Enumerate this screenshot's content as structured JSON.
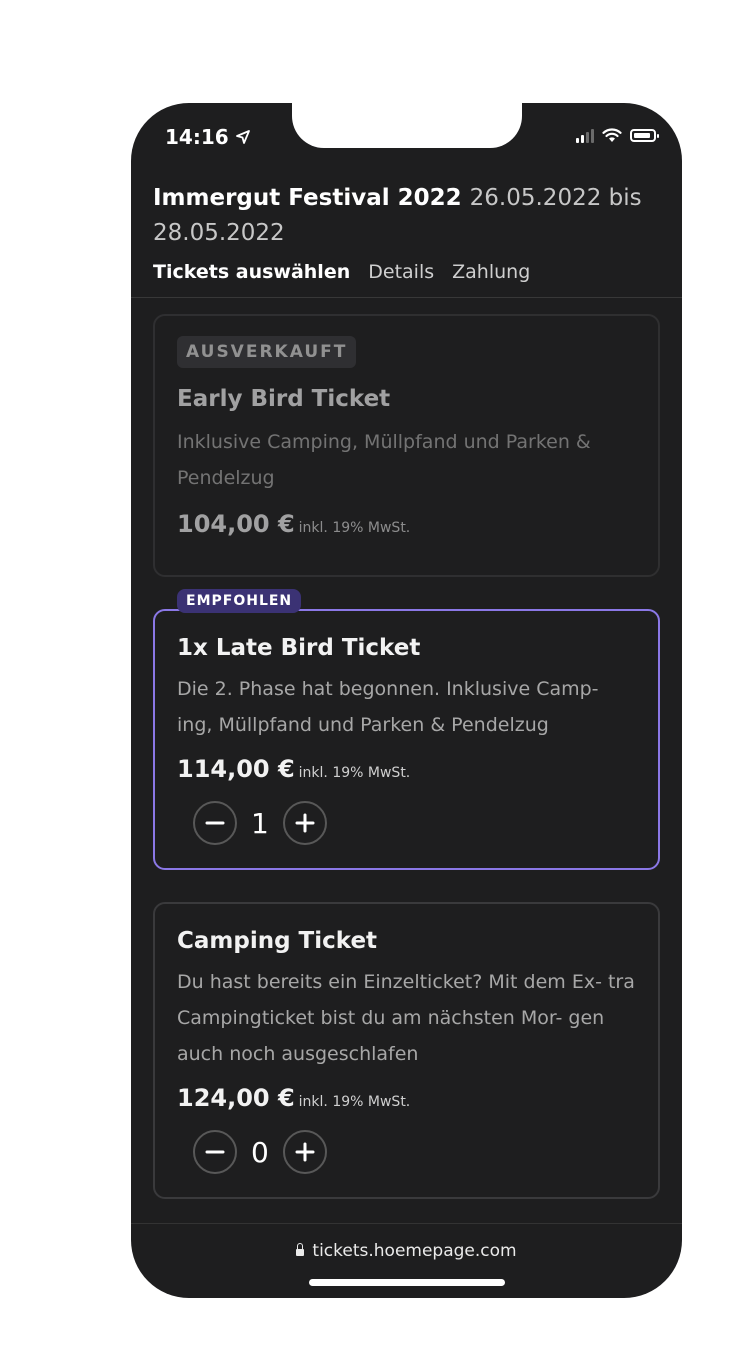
{
  "status": {
    "time": "14:16"
  },
  "header": {
    "event_name": "Immergut Festival 2022",
    "date_range": "26.05.2022 bis 28.05.2022"
  },
  "steps": [
    {
      "label": "Tickets auswählen",
      "active": true
    },
    {
      "label": "Details",
      "active": false
    },
    {
      "label": "Zahlung",
      "active": false
    }
  ],
  "tickets": [
    {
      "badge": "AUSVERKAUFT",
      "title": "Early Bird Ticket",
      "description": "Inklusive Camping, Müllpfand und Parken & Pendelzug",
      "price": "104,00 €",
      "tax_note": "inkl. 19% MwSt."
    },
    {
      "badge": "EMPFOHLEN",
      "title": "1x Late Bird Ticket",
      "description": "Die 2. Phase hat begonnen. Inklusive Camp- ing, Müllpfand und Parken & Pendelzug",
      "price": "114,00 €",
      "tax_note": "inkl. 19% MwSt.",
      "quantity": "1"
    },
    {
      "title": "Camping Ticket",
      "description": "Du hast bereits ein Einzelticket? Mit dem Ex- tra Campingticket bist du am nächsten Mor- gen auch noch ausgeschlafen",
      "price": "124,00 €",
      "tax_note": "inkl. 19% MwSt.",
      "quantity": "0"
    }
  ],
  "footer": {
    "url": "tickets.hoemepage.com"
  },
  "colors": {
    "accent": "#8b78e6",
    "badge_recommended": "#3b3274",
    "background": "#1e1e1f"
  },
  "icons": {
    "minus": "−",
    "plus": "+"
  }
}
